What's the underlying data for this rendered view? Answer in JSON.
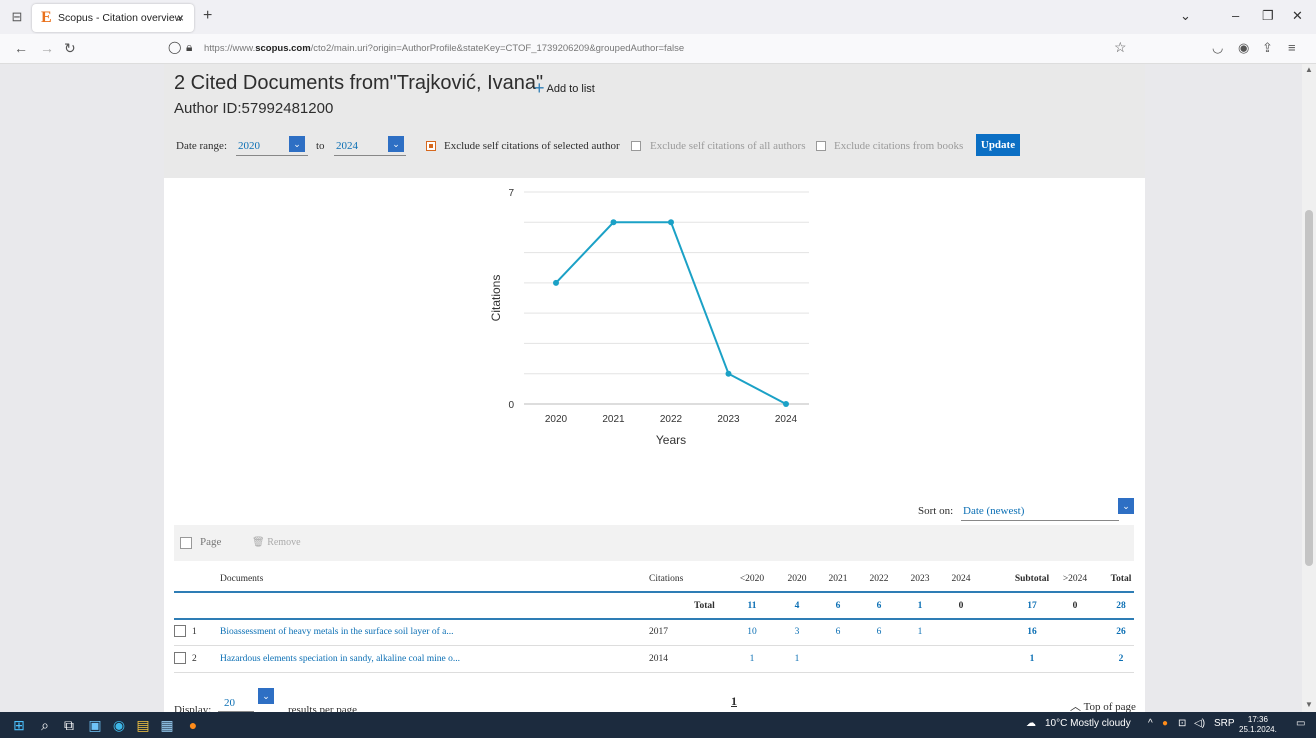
{
  "browser": {
    "tab_favicon": "E",
    "tab_title": "Scopus - Citation overview",
    "tab_close": "×",
    "new_tab": "+",
    "url_host": "https://www.",
    "url_domain": "scopus.com",
    "url_path": "/cto2/main.uri?origin=AuthorProfile&stateKey=CTOF_1739206209&groupedAuthor=false",
    "nav_icons": [
      "back-arrow-icon",
      "forward-arrow-icon",
      "reload-icon"
    ],
    "toolbar_icons": [
      "pocket-icon",
      "account-icon",
      "extensions-icon",
      "menu-icon"
    ]
  },
  "header": {
    "title": "2 Cited Documents from\"Trajković, Ivana\"",
    "add_to_list": "Add to list",
    "author_id": "Author ID:57992481200"
  },
  "controls": {
    "date_range_label": "Date range:",
    "from_year": "2020",
    "to_label": "to",
    "to_year": "2024",
    "exclude_self_selected": "Exclude self citations of selected author",
    "exclude_self_all": "Exclude self citations of all authors",
    "exclude_books": "Exclude citations from books",
    "update": "Update"
  },
  "chart_data": {
    "type": "line",
    "x": [
      "2020",
      "2021",
      "2022",
      "2023",
      "2024"
    ],
    "series": [
      {
        "values": [
          4,
          6,
          6,
          1,
          0
        ]
      }
    ],
    "ylim": [
      0,
      7
    ],
    "yticks_labeled": [
      "0",
      "7"
    ],
    "ylabel": "Citations",
    "xlabel": "Years",
    "color": "#1ba1c6",
    "grid": true
  },
  "sort": {
    "label": "Sort on:",
    "value": "Date (newest)"
  },
  "actions": {
    "page": "Page",
    "remove": "Remove"
  },
  "table": {
    "headers": {
      "documents": "Documents",
      "citations": "Citations",
      "lt2020": "<2020",
      "y2020": "2020",
      "y2021": "2021",
      "y2022": "2022",
      "y2023": "2023",
      "y2024": "2024",
      "subtotal": "Subtotal",
      "gt2024": ">2024",
      "total": "Total"
    },
    "total_row": {
      "label": "Total",
      "lt2020": "11",
      "y2020": "4",
      "y2021": "6",
      "y2022": "6",
      "y2023": "1",
      "y2024": "0",
      "subtotal": "17",
      "gt2024": "0",
      "total": "28"
    },
    "rows": [
      {
        "n": "1",
        "title": "Bioassessment of heavy metals in the surface soil layer of a...",
        "year": "2017",
        "lt2020": "10",
        "y2020": "3",
        "y2021": "6",
        "y2022": "6",
        "y2023": "1",
        "subtotal": "16",
        "total": "26"
      },
      {
        "n": "2",
        "title": "Hazardous elements speciation in sandy, alkaline coal mine o...",
        "year": "2014",
        "lt2020": "1",
        "y2020": "1",
        "y2021": "",
        "y2022": "",
        "y2023": "",
        "subtotal": "1",
        "total": "2"
      }
    ]
  },
  "pagination": {
    "display_label": "Display:",
    "per_page_value": "20",
    "per_page_label": "results per page",
    "current_page": "1",
    "top_of_page": "Top of page"
  },
  "taskbar": {
    "weather": "10°C  Mostly cloudy",
    "lang": "SRP",
    "time": "17:36",
    "date": "25.1.2024."
  }
}
